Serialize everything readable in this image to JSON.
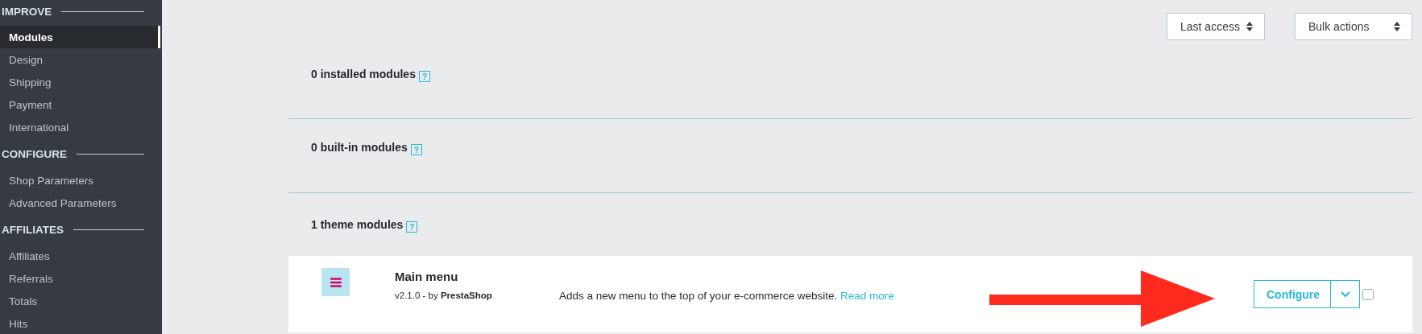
{
  "sidebar": {
    "groups": [
      {
        "title": "IMPROVE",
        "items": [
          {
            "label": "Modules",
            "selected": true
          },
          {
            "label": "Design",
            "selected": false
          },
          {
            "label": "Shipping",
            "selected": false
          },
          {
            "label": "Payment",
            "selected": false
          },
          {
            "label": "International",
            "selected": false
          }
        ]
      },
      {
        "title": "CONFIGURE",
        "items": [
          {
            "label": "Shop Parameters",
            "selected": false
          },
          {
            "label": "Advanced Parameters",
            "selected": false
          }
        ]
      },
      {
        "title": "AFFILIATES",
        "items": [
          {
            "label": "Affiliates",
            "selected": false
          },
          {
            "label": "Referrals",
            "selected": false
          },
          {
            "label": "Totals",
            "selected": false
          },
          {
            "label": "Hits",
            "selected": false
          }
        ]
      }
    ]
  },
  "toolbar": {
    "selects": [
      {
        "value": "Last access"
      },
      {
        "value": "Bulk actions"
      }
    ]
  },
  "sections": [
    {
      "title": "0 installed modules",
      "help": "?"
    },
    {
      "title": "0 built-in modules",
      "help": "?"
    },
    {
      "title": "1 theme modules",
      "help": "?",
      "modules": [
        {
          "name": "Main menu",
          "version": "v2.1.0 - by **PrestaShop**",
          "description": "Adds a new menu to the top of your e-commerce website.",
          "link": "Read more",
          "action": "Configure",
          "checked": false
        }
      ]
    }
  ]
}
